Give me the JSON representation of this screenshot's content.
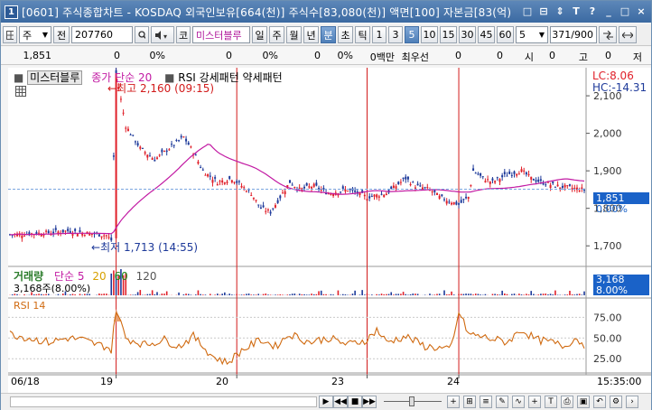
{
  "window": {
    "app_number": "1",
    "title": "[0601] 주식종합차트 - KOSDAQ 외국인보유[664(천)] 주식수[83,080(천)] 액면[100] 자본금[83(억)",
    "buttons": [
      "□",
      "⊟",
      "⇕",
      "T",
      "?",
      "_",
      "□",
      "×"
    ]
  },
  "toolbar": {
    "market": "주",
    "prev_label": "전",
    "code": "207760",
    "code_type": "코",
    "stock_name": "미스터블루",
    "periods": [
      "일",
      "주",
      "월",
      "년",
      "분",
      "초",
      "틱"
    ],
    "active_period": "분",
    "intervals": [
      "1",
      "3",
      "5",
      "10",
      "15",
      "30",
      "45",
      "60"
    ],
    "active_interval": "5",
    "interval_value": "5",
    "count": "371",
    "count_total": "/900"
  },
  "info": {
    "price": "1,851",
    "change": "0",
    "change_pct": "0%",
    "v1": "0",
    "v1_pct": "0%",
    "v2": "0",
    "v2_pct": "0%",
    "mid_label": "0백만",
    "quote_label": "최우선",
    "q1": "0",
    "q2": "0",
    "open_label": "시",
    "open": "0",
    "high_label": "고",
    "high": "0",
    "low_label": "저"
  },
  "price_legend": {
    "name": "미스터블루",
    "ma": "종가 단순 20",
    "rsi_tag": "RSI 강세패턴 약세패턴"
  },
  "price_right": {
    "lc": "LC:8.06",
    "hc": "HC:-14.31",
    "current": "1,851",
    "current_pct": "0.00%"
  },
  "volume_legend": {
    "title": "거래량",
    "ma_label": "단순",
    "ma_periods": [
      "5",
      "20",
      "60",
      "120"
    ],
    "current": "3,168주(8.00%)",
    "right_value": "3,168",
    "right_pct": "8.00%"
  },
  "rsi_legend": {
    "title": "RSI 14"
  },
  "annotations": {
    "high": "최고 2,160 (09:15)",
    "low": "최저 1,713 (14:55)"
  },
  "x_axis": {
    "labels": [
      "06/18",
      "19",
      "20",
      "23",
      "24"
    ],
    "last_time": "15:35:00"
  },
  "colors": {
    "up": "#e0202a",
    "down": "#1e3a9a",
    "ma20": "#c21aa3",
    "rsi": "#d06a10",
    "rsi_fill": "#e8a070",
    "label_box": "#1a62c8",
    "vline": "#d21b1b"
  },
  "chart_data": {
    "type": "candlestick",
    "price_axis": {
      "ticks": [
        2100,
        2000,
        1900,
        1851,
        1800,
        1700
      ],
      "tick_labels": [
        "2,100",
        "2,000",
        "1,900",
        "1,851",
        "1,800",
        "1,700"
      ],
      "ylim": [
        1650,
        2170
      ]
    },
    "rsi_axis": {
      "ticks": [
        75,
        50,
        25
      ],
      "tick_labels": [
        "75.00",
        "50.00",
        "25.00"
      ],
      "ylim": [
        10,
        95
      ]
    },
    "day_boundaries": [
      19,
      20,
      23,
      24
    ],
    "high": {
      "value": 2160,
      "time": "09:15"
    },
    "low": {
      "value": 1713,
      "time": "14:55"
    },
    "price_path": [
      [
        0,
        1730
      ],
      [
        8,
        1735
      ],
      [
        12,
        1740
      ],
      [
        15,
        1735
      ],
      [
        20,
        1728
      ],
      [
        21,
        1715
      ],
      [
        22,
        2160
      ],
      [
        24,
        2020
      ],
      [
        27,
        1960
      ],
      [
        30,
        1930
      ],
      [
        33,
        1960
      ],
      [
        36,
        1990
      ],
      [
        38,
        1950
      ],
      [
        40,
        1900
      ],
      [
        43,
        1870
      ],
      [
        46,
        1880
      ],
      [
        48,
        1860
      ],
      [
        50,
        1840
      ],
      [
        52,
        1800
      ],
      [
        54,
        1790
      ],
      [
        56,
        1830
      ],
      [
        58,
        1870
      ],
      [
        60,
        1850
      ],
      [
        63,
        1860
      ],
      [
        66,
        1840
      ],
      [
        70,
        1850
      ],
      [
        74,
        1830
      ],
      [
        78,
        1840
      ],
      [
        80,
        1860
      ],
      [
        82,
        1880
      ],
      [
        84,
        1860
      ],
      [
        87,
        1850
      ],
      [
        89,
        1830
      ],
      [
        91,
        1820
      ],
      [
        93,
        1810
      ],
      [
        95,
        1830
      ],
      [
        96,
        1900
      ],
      [
        98,
        1880
      ],
      [
        100,
        1870
      ],
      [
        103,
        1890
      ],
      [
        106,
        1900
      ],
      [
        108,
        1880
      ],
      [
        110,
        1870
      ],
      [
        113,
        1860
      ],
      [
        116,
        1855
      ],
      [
        119,
        1850
      ]
    ],
    "rsi_path": [
      [
        0,
        55
      ],
      [
        4,
        50
      ],
      [
        8,
        45
      ],
      [
        12,
        50
      ],
      [
        15,
        48
      ],
      [
        18,
        42
      ],
      [
        20,
        40
      ],
      [
        21,
        35
      ],
      [
        22,
        85
      ],
      [
        24,
        50
      ],
      [
        28,
        42
      ],
      [
        32,
        48
      ],
      [
        35,
        40
      ],
      [
        38,
        52
      ],
      [
        42,
        28
      ],
      [
        45,
        20
      ],
      [
        48,
        35
      ],
      [
        52,
        48
      ],
      [
        55,
        40
      ],
      [
        58,
        55
      ],
      [
        62,
        45
      ],
      [
        66,
        50
      ],
      [
        70,
        42
      ],
      [
        74,
        48
      ],
      [
        76,
        60
      ],
      [
        78,
        45
      ],
      [
        82,
        52
      ],
      [
        86,
        40
      ],
      [
        89,
        38
      ],
      [
        91,
        35
      ],
      [
        92,
        50
      ],
      [
        93,
        82
      ],
      [
        95,
        55
      ],
      [
        99,
        50
      ],
      [
        103,
        45
      ],
      [
        106,
        60
      ],
      [
        109,
        48
      ],
      [
        112,
        45
      ],
      [
        115,
        40
      ],
      [
        117,
        50
      ],
      [
        119,
        42
      ]
    ]
  }
}
